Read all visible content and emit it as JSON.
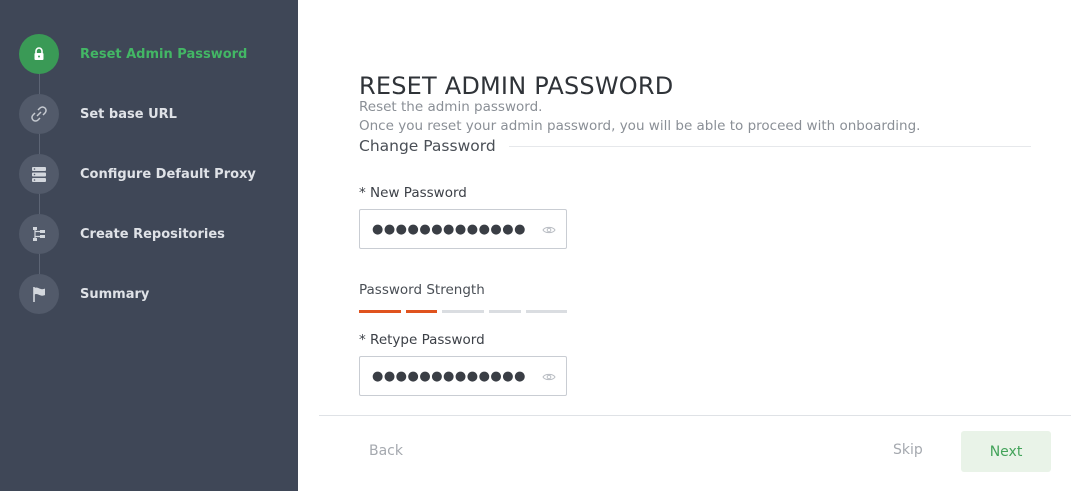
{
  "sidebar": {
    "steps": [
      {
        "label": "Reset Admin Password",
        "icon": "lock-icon",
        "active": true
      },
      {
        "label": "Set base URL",
        "icon": "link-icon",
        "active": false
      },
      {
        "label": "Configure Default Proxy",
        "icon": "server-icon",
        "active": false
      },
      {
        "label": "Create Repositories",
        "icon": "repository-tree-icon",
        "active": false
      },
      {
        "label": "Summary",
        "icon": "flag-icon",
        "active": false
      }
    ]
  },
  "main": {
    "title": "RESET ADMIN PASSWORD",
    "subtitle": "Reset the admin password.",
    "description": "Once you reset your admin password, you will be able to proceed with onboarding.",
    "section_title": "Change Password",
    "new_password": {
      "required_mark": "* ",
      "label": "New Password",
      "value": "●●●●●●●●●●●●●"
    },
    "strength": {
      "label": "Password Strength",
      "level": 2,
      "max": 5
    },
    "retype_password": {
      "required_mark": "* ",
      "label": "Retype Password",
      "value": "●●●●●●●●●●●●●"
    }
  },
  "footer": {
    "back_label": "Back",
    "skip_label": "Skip",
    "next_label": "Next"
  },
  "colors": {
    "sidebar_bg": "#3f4757",
    "active_green": "#43b765",
    "strength_on": "#e0531e",
    "next_bg": "#e9f3e8"
  }
}
